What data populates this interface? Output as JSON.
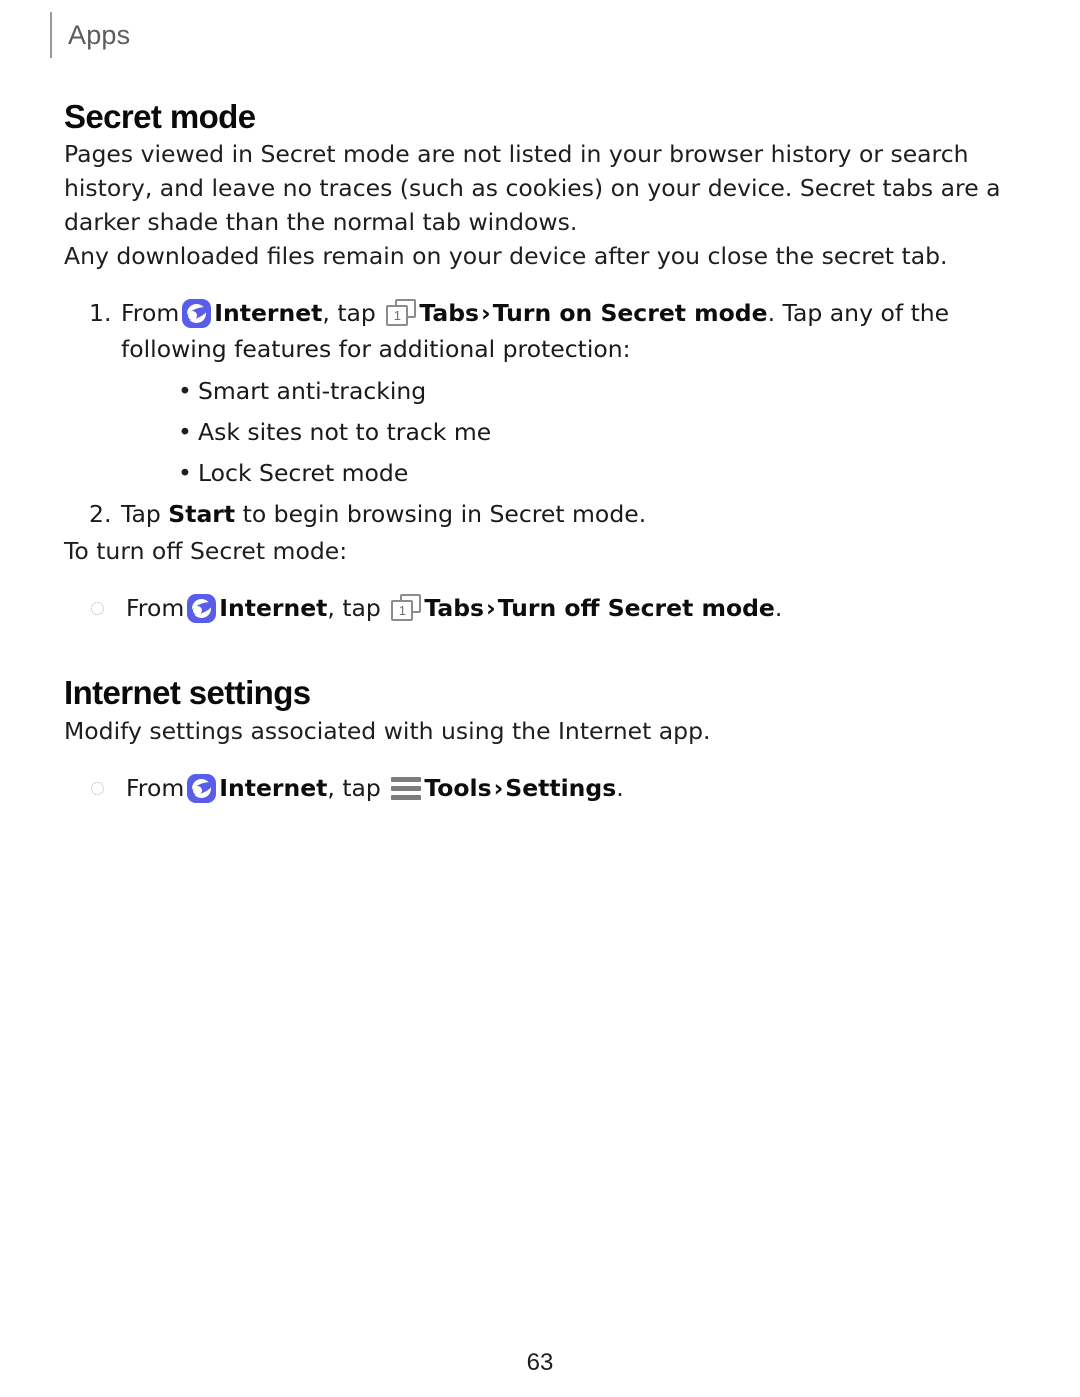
{
  "header": {
    "running_head": "Apps"
  },
  "sections": [
    {
      "title": "Secret mode",
      "paragraphs": [
        "Pages viewed in Secret mode are not listed in your browser history or search history, and leave no traces (such as cookies) on your device. Secret tabs are a darker shade than the normal tab windows.",
        "Any downloaded files remain on your device after you close the secret tab."
      ],
      "steps": [
        {
          "number": "1.",
          "prefix": "From",
          "app_name": "Internet",
          "mid": ", tap",
          "tabs_label": "Tabs",
          "chevron": "›",
          "action": "Turn on Secret mode",
          "suffix": ". Tap any of the following features for additional protection:"
        },
        {
          "number": "2.",
          "lead": "Tap",
          "emphasis": "Start",
          "tail": "to begin browsing in Secret mode."
        }
      ],
      "bullets": [
        "Smart anti-tracking",
        "Ask sites not to track me",
        "Lock Secret mode"
      ],
      "turn_off_intro": "To turn off Secret mode:",
      "turn_off_step": {
        "prefix": "From",
        "app_name": "Internet",
        "mid": ", tap",
        "tabs_label": "Tabs",
        "chevron": "›",
        "action": "Turn off Secret mode",
        "suffix": "."
      }
    },
    {
      "title": "Internet settings",
      "paragraph": "Modify settings associated with using the Internet app.",
      "step": {
        "prefix": "From",
        "app_name": "Internet",
        "mid": ", tap",
        "tools_label": "Tools",
        "chevron": "›",
        "action": "Settings",
        "suffix": "."
      }
    }
  ],
  "icons": {
    "internet": "samsung-internet-icon",
    "tabs": "tabs-icon",
    "tabs_count": "1",
    "tools": "tools-hamburger-icon"
  },
  "colors": {
    "internet_blue": "#5a5cea",
    "icon_gray": "#8c8c8c",
    "header_gray": "#595d60"
  },
  "footer": {
    "page_number": "63"
  }
}
